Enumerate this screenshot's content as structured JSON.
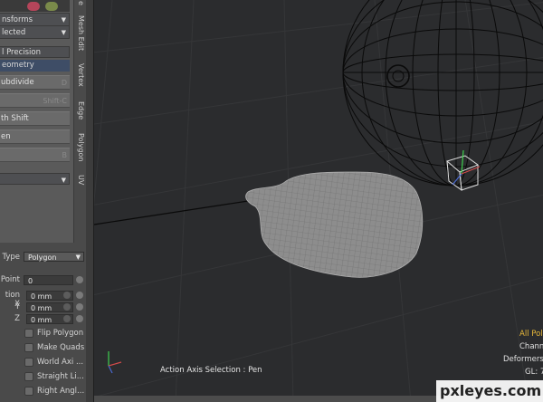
{
  "left_panel": {
    "transforms_dropdown": "nsforms",
    "selected_dropdown": "lected",
    "precision_label": "l Precision",
    "geometry_header": "eometry",
    "subdivide_label": "ubdivide",
    "subdivide_shortcut": "D",
    "subdivide_shift_shortcut": "Shift-C",
    "smooth_shift_label": "th Shift",
    "pen_label": "en",
    "pen_shortcut": "B"
  },
  "vertical_tabs": [
    "Mesh Edit",
    "Vertex",
    "Edge",
    "Polygon",
    "UV"
  ],
  "pen_tool": {
    "type_label": "Type",
    "type_value": "Polygon",
    "point_label": "Point",
    "point_value": "0",
    "position_x_label": "tion X",
    "position_x": "0 mm",
    "position_y_label": "Y",
    "position_y": "0 mm",
    "position_z_label": "Z",
    "position_z": "0 mm",
    "checkboxes": [
      "Flip Polygon",
      "Make Quads",
      "World Axi ...",
      "Straight Li...",
      "Right Angl..."
    ]
  },
  "viewport": {
    "status_text": "Action Axis Selection : Pen",
    "info_lines": [
      "All Poly",
      "Chann",
      "Deformers",
      "GL: 7"
    ],
    "info_accent": "#e8b93a",
    "mesh_color": "#8d8d8d",
    "wire_color": "#0a0a0a"
  },
  "watermark": "pxleyes.com"
}
